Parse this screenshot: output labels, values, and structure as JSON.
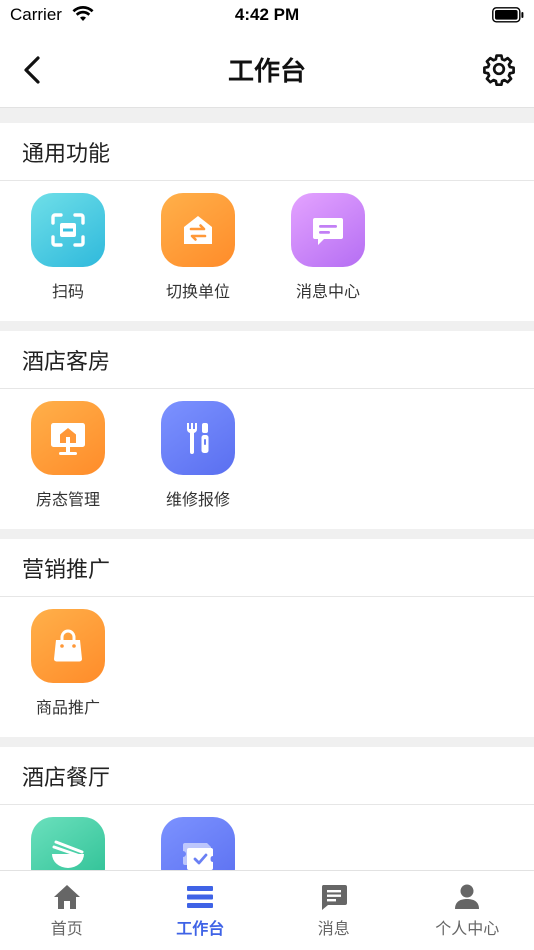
{
  "status_bar": {
    "carrier": "Carrier",
    "time": "4:42 PM"
  },
  "nav": {
    "title": "工作台",
    "back_icon": "chevron-left-icon",
    "settings_icon": "gear-icon"
  },
  "sections": [
    {
      "title": "通用功能",
      "items": [
        {
          "label": "扫码",
          "icon": "scan-icon",
          "color": "#2fb9dc"
        },
        {
          "label": "切换单位",
          "icon": "switch-house-icon",
          "color": "#ff8c2a"
        },
        {
          "label": "消息中心",
          "icon": "message-icon",
          "color": "#b56ef3"
        }
      ]
    },
    {
      "title": "酒店客房",
      "items": [
        {
          "label": "房态管理",
          "icon": "room-monitor-icon",
          "color": "#ff8c2a"
        },
        {
          "label": "维修报修",
          "icon": "tools-icon",
          "color": "#5a6ff0"
        }
      ]
    },
    {
      "title": "营销推广",
      "items": [
        {
          "label": "商品推广",
          "icon": "shopping-bag-icon",
          "color": "#ff8c2a"
        }
      ]
    },
    {
      "title": "酒店餐厅",
      "items": [
        {
          "label": "",
          "icon": "bowl-chopsticks-icon",
          "color": "#2bbf93"
        },
        {
          "label": "",
          "icon": "ticket-check-icon",
          "color": "#5a6ff0"
        }
      ]
    }
  ],
  "tabs": [
    {
      "label": "首页",
      "icon": "home-icon",
      "active": false
    },
    {
      "label": "工作台",
      "icon": "list-icon",
      "active": true
    },
    {
      "label": "消息",
      "icon": "chat-icon",
      "active": false
    },
    {
      "label": "个人中心",
      "icon": "person-icon",
      "active": false
    }
  ],
  "colors": {
    "accent": "#3f63e6",
    "inactive_tab": "#666666"
  }
}
